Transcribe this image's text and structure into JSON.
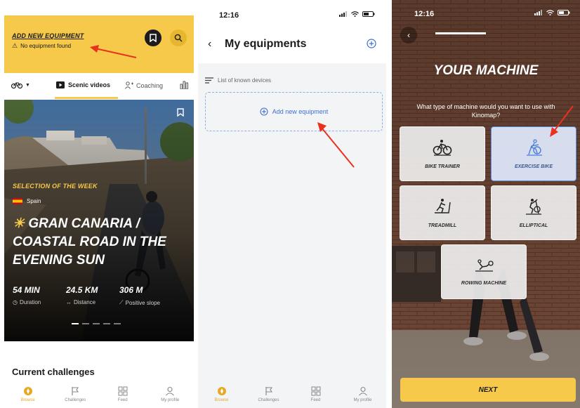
{
  "screen1": {
    "header": {
      "add_equipment_link": "ADD NEW EQUIPMENT",
      "no_equipment": "No equipment found"
    },
    "tabs": {
      "scenic": "Scenic videos",
      "coaching": "Coaching"
    },
    "hero": {
      "selection_label": "SELECTION OF THE WEEK",
      "country": "Spain",
      "title": "GRAN CANARIA / COASTAL ROAD IN THE EVENING SUN",
      "stats": [
        {
          "value": "54 MIN",
          "label": "Duration"
        },
        {
          "value": "24.5 KM",
          "label": "Distance"
        },
        {
          "value": "306 M",
          "label": "Positive slope"
        }
      ],
      "carousel_dots": 5,
      "carousel_active": 0
    },
    "section_title": "Current challenges",
    "nav": [
      "Browse",
      "Challenges",
      "Feed",
      "My profile"
    ]
  },
  "screen2": {
    "time": "12:16",
    "title": "My equipments",
    "list_header": "List of known devices",
    "add_button": "Add new equipment",
    "nav": [
      "Browse",
      "Challenges",
      "Feed",
      "My profile"
    ]
  },
  "screen3": {
    "time": "12:16",
    "progress": 1.0,
    "title": "YOUR MACHINE",
    "question": "What type of machine would you want to use with Kinomap?",
    "machines": [
      {
        "label": "BIKE TRAINER",
        "icon": "bike-trainer-icon",
        "selected": false
      },
      {
        "label": "EXERCISE BIKE",
        "icon": "exercise-bike-icon",
        "selected": true
      },
      {
        "label": "TREADMILL",
        "icon": "treadmill-icon",
        "selected": false
      },
      {
        "label": "ELLIPTICAL",
        "icon": "elliptical-icon",
        "selected": false
      },
      {
        "label": "ROWING MACHINE",
        "icon": "rowing-machine-icon",
        "selected": false
      }
    ],
    "next_button": "NEXT"
  },
  "colors": {
    "brand_yellow": "#f6c94a",
    "annotation_red": "#e8321e",
    "link_blue": "#3d6fd2"
  }
}
